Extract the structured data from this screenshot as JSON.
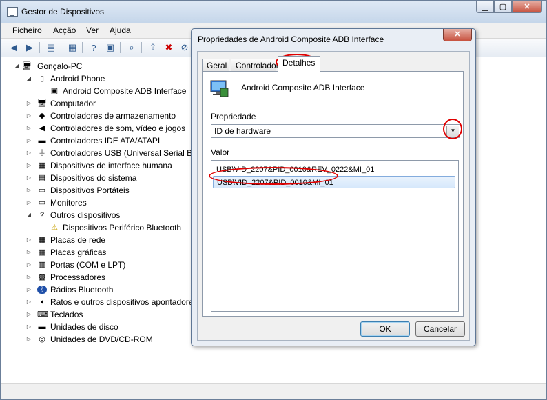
{
  "window": {
    "title": "Gestor de Dispositivos"
  },
  "menu": [
    "Ficheiro",
    "Acção",
    "Ver",
    "Ajuda"
  ],
  "tree": {
    "root": "Gonçalo-PC",
    "items": [
      {
        "label": "Android Phone",
        "level": 1,
        "expander": "open",
        "icon": "phone-icon"
      },
      {
        "label": "Android Composite ADB Interface",
        "level": 2,
        "expander": "none",
        "icon": "adb-device-icon"
      },
      {
        "label": "Computador",
        "level": 1,
        "expander": "closed",
        "icon": "computer-icon"
      },
      {
        "label": "Controladores de armazenamento",
        "level": 1,
        "expander": "closed",
        "icon": "storage-icon"
      },
      {
        "label": "Controladores de som, vídeo e jogos",
        "level": 1,
        "expander": "closed",
        "icon": "speaker-icon"
      },
      {
        "label": "Controladores IDE ATA/ATAPI",
        "level": 1,
        "expander": "closed",
        "icon": "ide-icon"
      },
      {
        "label": "Controladores USB (Universal Serial Bus",
        "level": 1,
        "expander": "closed",
        "icon": "usb-icon"
      },
      {
        "label": "Dispositivos de interface humana",
        "level": 1,
        "expander": "closed",
        "icon": "hid-icon"
      },
      {
        "label": "Dispositivos do sistema",
        "level": 1,
        "expander": "closed",
        "icon": "system-icon"
      },
      {
        "label": "Dispositivos Portáteis",
        "level": 1,
        "expander": "closed",
        "icon": "portable-icon"
      },
      {
        "label": "Monitores",
        "level": 1,
        "expander": "closed",
        "icon": "monitor-icon"
      },
      {
        "label": "Outros dispositivos",
        "level": 1,
        "expander": "open",
        "icon": "other-devices-icon"
      },
      {
        "label": "Dispositivos Periférico Bluetooth",
        "level": 2,
        "expander": "none",
        "icon": "warning-icon"
      },
      {
        "label": "Placas de rede",
        "level": 1,
        "expander": "closed",
        "icon": "network-icon"
      },
      {
        "label": "Placas gráficas",
        "level": 1,
        "expander": "closed",
        "icon": "display-adapter-icon"
      },
      {
        "label": "Portas (COM e LPT)",
        "level": 1,
        "expander": "closed",
        "icon": "port-icon"
      },
      {
        "label": "Processadores",
        "level": 1,
        "expander": "closed",
        "icon": "cpu-icon"
      },
      {
        "label": "Rádios Bluetooth",
        "level": 1,
        "expander": "closed",
        "icon": "bluetooth-icon"
      },
      {
        "label": "Ratos e outros dispositivos apontadore",
        "level": 1,
        "expander": "closed",
        "icon": "mouse-icon"
      },
      {
        "label": "Teclados",
        "level": 1,
        "expander": "closed",
        "icon": "keyboard-icon"
      },
      {
        "label": "Unidades de disco",
        "level": 1,
        "expander": "closed",
        "icon": "disk-icon"
      },
      {
        "label": "Unidades de DVD/CD-ROM",
        "level": 1,
        "expander": "closed",
        "icon": "dvd-icon"
      }
    ]
  },
  "dialog": {
    "title": "Propriedades de Android Composite ADB Interface",
    "tabs": [
      "Geral",
      "Controlador",
      "Detalhes"
    ],
    "active_tab": "Detalhes",
    "device_name": "Android Composite ADB Interface",
    "property_label": "Propriedade",
    "property_value": "ID de hardware",
    "value_label": "Valor",
    "values": [
      "USB\\VID_2207&PID_0010&REV_0222&MI_01",
      "USB\\VID_2207&PID_0010&MI_01"
    ],
    "selected_value_index": 1,
    "ok_label": "OK",
    "cancel_label": "Cancelar"
  },
  "colors": {
    "annotation": "#e00000",
    "selection": "#d6e8fb",
    "title_gradient": "#c5d6ea"
  }
}
